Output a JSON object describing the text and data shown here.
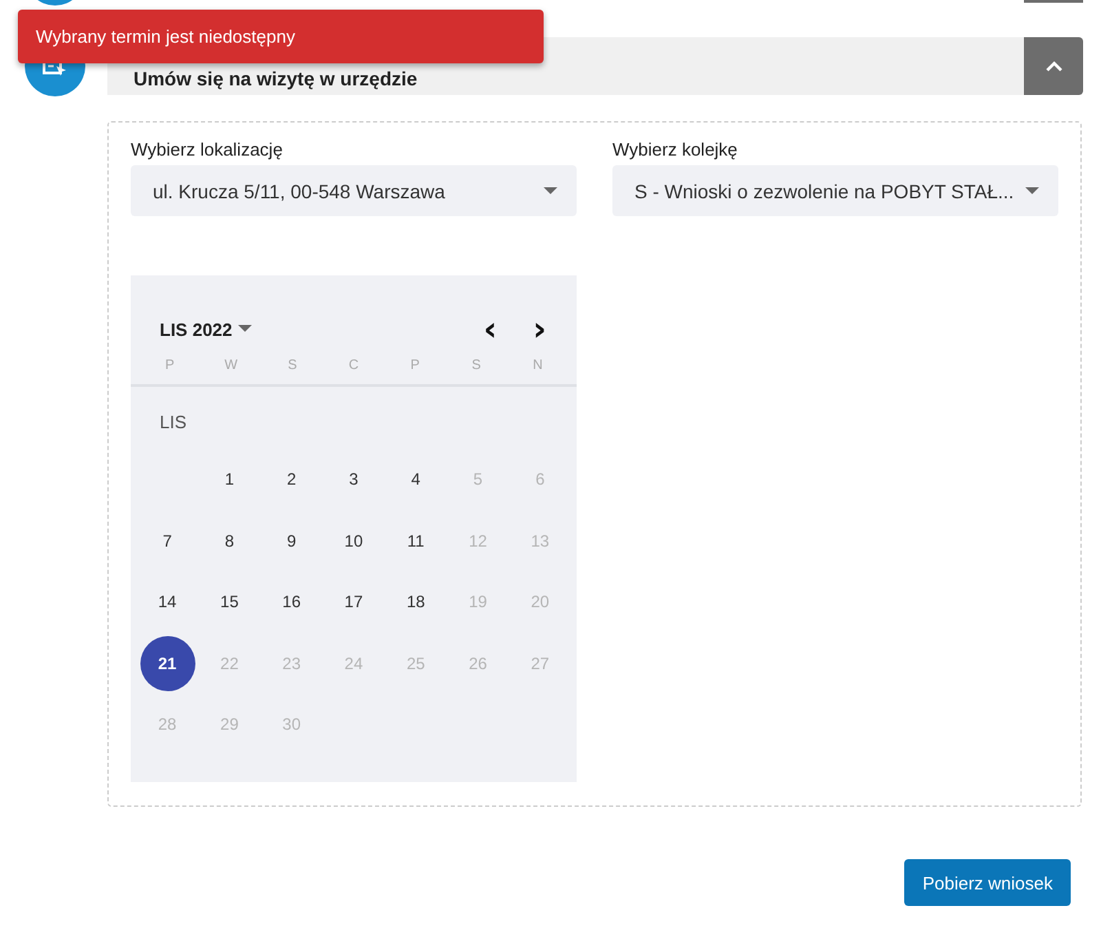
{
  "toast": {
    "message": "Wybrany termin jest niedostępny"
  },
  "step": {
    "title": "Umów się na wizytę w urzędzie",
    "expanded": true
  },
  "fields": [
    {
      "label": "Wybierz lokalizację",
      "value": "ul. Krucza 5/11, 00-548 Warszawa"
    },
    {
      "label": "Wybierz kolejkę",
      "value": "S - Wnioski o zezwolenie na POBYT STAŁ..."
    }
  ],
  "calendar": {
    "month_label": "LIS 2022",
    "prev": "‹",
    "next": "›",
    "weekdays": [
      "P",
      "W",
      "S",
      "C",
      "P",
      "S",
      "N"
    ],
    "month_heading": "LIS",
    "weeks": [
      [
        {
          "day": "1",
          "disabled": false,
          "selected": false
        },
        {
          "day": "2",
          "disabled": false,
          "selected": false
        },
        {
          "day": "3",
          "disabled": false,
          "selected": false
        },
        {
          "day": "4",
          "disabled": false,
          "selected": false
        },
        {
          "day": "5",
          "disabled": true,
          "selected": false
        },
        {
          "day": "6",
          "disabled": true,
          "selected": false
        }
      ],
      [
        {
          "day": "7",
          "disabled": false,
          "selected": false
        },
        {
          "day": "8",
          "disabled": false,
          "selected": false
        },
        {
          "day": "9",
          "disabled": false,
          "selected": false
        },
        {
          "day": "10",
          "disabled": false,
          "selected": false
        },
        {
          "day": "11",
          "disabled": false,
          "selected": false
        },
        {
          "day": "12",
          "disabled": true,
          "selected": false
        },
        {
          "day": "13",
          "disabled": true,
          "selected": false
        }
      ],
      [
        {
          "day": "14",
          "disabled": false,
          "selected": false
        },
        {
          "day": "15",
          "disabled": false,
          "selected": false
        },
        {
          "day": "16",
          "disabled": false,
          "selected": false
        },
        {
          "day": "17",
          "disabled": false,
          "selected": false
        },
        {
          "day": "18",
          "disabled": false,
          "selected": false
        },
        {
          "day": "19",
          "disabled": true,
          "selected": false
        },
        {
          "day": "20",
          "disabled": true,
          "selected": false
        }
      ],
      [
        {
          "day": "21",
          "disabled": false,
          "selected": true
        },
        {
          "day": "22",
          "disabled": true,
          "selected": false
        },
        {
          "day": "23",
          "disabled": true,
          "selected": false
        },
        {
          "day": "24",
          "disabled": true,
          "selected": false
        },
        {
          "day": "25",
          "disabled": true,
          "selected": false
        },
        {
          "day": "26",
          "disabled": true,
          "selected": false
        },
        {
          "day": "27",
          "disabled": true,
          "selected": false
        }
      ],
      [
        {
          "day": "28",
          "disabled": true,
          "selected": false
        },
        {
          "day": "29",
          "disabled": true,
          "selected": false
        },
        {
          "day": "30",
          "disabled": true,
          "selected": false
        }
      ]
    ]
  },
  "download_button": "Pobierz wniosek"
}
